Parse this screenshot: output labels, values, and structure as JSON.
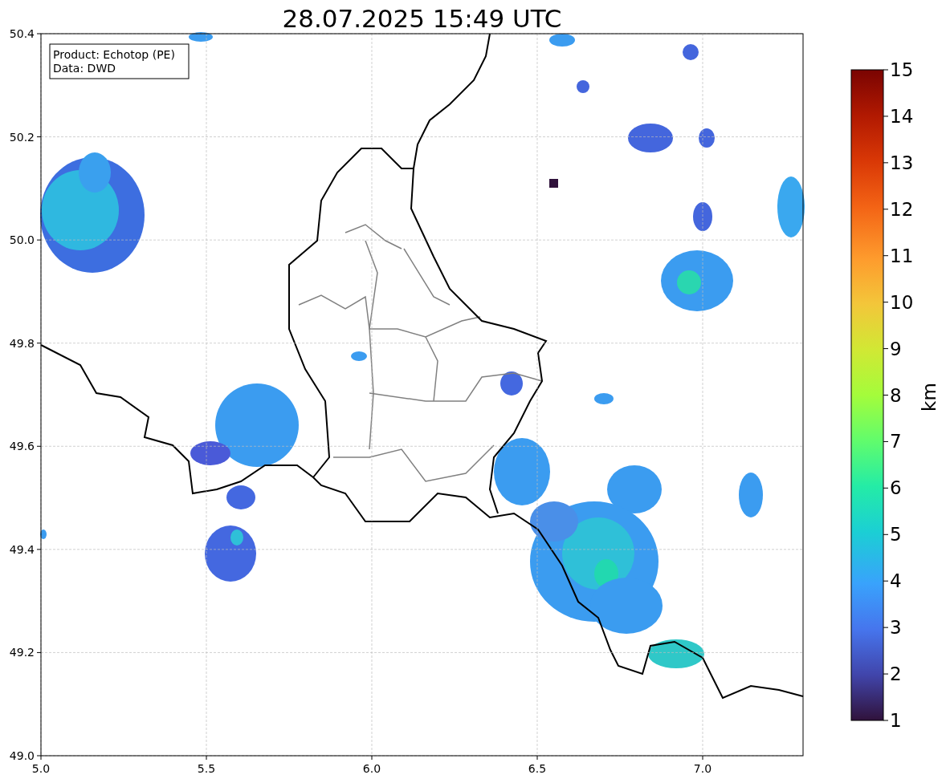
{
  "title": "28.07.2025 15:49 UTC",
  "legend": [
    "Product: Echotop (PE)",
    "Data: DWD"
  ],
  "x_axis": {
    "ticks": [
      "5.0",
      "5.5",
      "6.0",
      "6.5",
      "7.0"
    ]
  },
  "y_axis": {
    "ticks": [
      "50.4",
      "50.2",
      "50.0",
      "49.8",
      "49.6",
      "49.4",
      "49.2",
      "49.0"
    ]
  },
  "colorbar": {
    "label": "km",
    "ticks": [
      "15",
      "14",
      "13",
      "12",
      "11",
      "10",
      "9",
      "8",
      "7",
      "6",
      "5",
      "4",
      "3",
      "2",
      "1"
    ]
  }
}
